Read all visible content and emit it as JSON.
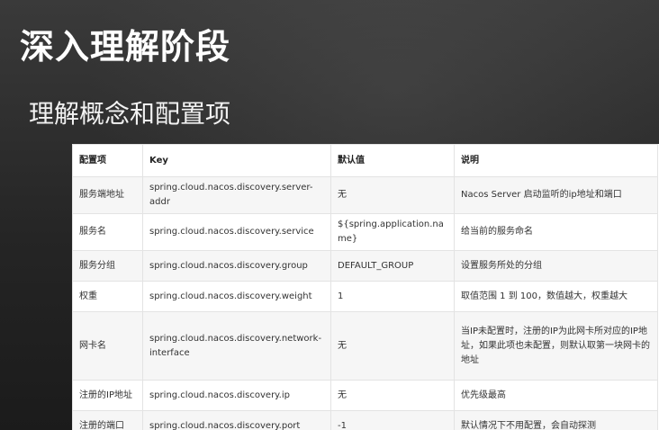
{
  "slide": {
    "title": "深入理解阶段",
    "subtitle": "理解概念和配置项"
  },
  "table": {
    "headers": [
      "配置项",
      "Key",
      "默认值",
      "说明"
    ],
    "rows": [
      [
        "服务端地址",
        "spring.cloud.nacos.discovery.server-addr",
        "无",
        "Nacos Server 启动监听的ip地址和端口"
      ],
      [
        "服务名",
        "spring.cloud.nacos.discovery.service",
        "${spring.application.name}",
        "给当前的服务命名"
      ],
      [
        "服务分组",
        "spring.cloud.nacos.discovery.group",
        "DEFAULT_GROUP",
        "设置服务所处的分组"
      ],
      [
        "权重",
        "spring.cloud.nacos.discovery.weight",
        "1",
        "取值范围 1 到 100，数值越大，权重越大"
      ],
      [
        "网卡名",
        "spring.cloud.nacos.discovery.network-interface",
        "无",
        "当IP未配置时，注册的IP为此网卡所对应的IP地址，如果此项也未配置，则默认取第一块网卡的地址"
      ],
      [
        "注册的IP地址",
        "spring.cloud.nacos.discovery.ip",
        "无",
        "优先级最高"
      ],
      [
        "注册的端口",
        "spring.cloud.nacos.discovery.port",
        "-1",
        "默认情况下不用配置，会自动探测"
      ]
    ]
  }
}
